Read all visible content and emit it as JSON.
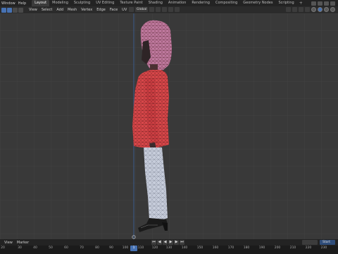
{
  "top_menu": [
    "Window",
    "Help"
  ],
  "workspace_tabs": [
    "Layout",
    "Modeling",
    "Sculpting",
    "UV Editing",
    "Texture Paint",
    "Shading",
    "Animation",
    "Rendering",
    "Compositing",
    "Geometry Nodes",
    "Scripting"
  ],
  "active_tab": "Layout",
  "workspace_add": "+",
  "header_menu": [
    "View",
    "Select",
    "Add",
    "Mesh",
    "Vertex",
    "Edge",
    "Face",
    "UV"
  ],
  "transform_orientation": "Global",
  "timeline": {
    "menu": [
      "View",
      "Marker"
    ],
    "transport": [
      "⏮",
      "◀",
      "◀",
      "▶",
      "▶",
      "⏭"
    ],
    "start_label": "Start",
    "current_frame": "1",
    "ruler_ticks": [
      "20",
      "30",
      "40",
      "50",
      "60",
      "70",
      "80",
      "90",
      "100",
      "110",
      "120",
      "130",
      "140",
      "150",
      "160",
      "170",
      "180",
      "190",
      "200",
      "210",
      "220",
      "230"
    ]
  },
  "colors": {
    "accent": "#4772b3",
    "jacket": "#d9474a",
    "wire": "#3a0f10",
    "hair": "#c07aa0",
    "pants": "#c7cddb"
  },
  "icons": [
    "editor-type-icon",
    "vertex-select-icon",
    "edge-select-icon",
    "face-select-icon",
    "transform-orientation-icon",
    "pivot-icon",
    "snap-icon",
    "proportional-edit-icon",
    "solid-shading-icon",
    "wireframe-shading-icon",
    "material-shading-icon",
    "rendered-shading-icon"
  ]
}
